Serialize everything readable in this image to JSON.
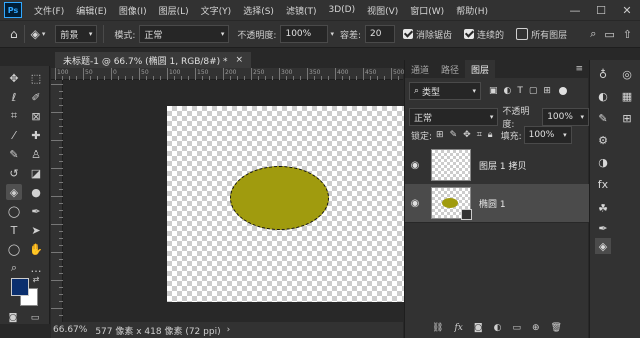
{
  "app": {
    "logo": "Ps"
  },
  "menu": [
    "文件(F)",
    "编辑(E)",
    "图像(I)",
    "图层(L)",
    "文字(Y)",
    "选择(S)",
    "滤镜(T)",
    "3D(D)",
    "视图(V)",
    "窗口(W)",
    "帮助(H)"
  ],
  "window_controls": {
    "minimize": "—",
    "maximize": "☐",
    "close": "✕"
  },
  "options": {
    "preset": "前景",
    "mode_label": "模式:",
    "mode_value": "正常",
    "opacity_label": "不透明度:",
    "opacity_value": "100%",
    "tolerance_label": "容差:",
    "tolerance_value": "20",
    "antialias_label": "消除锯齿",
    "antialias_checked": true,
    "contiguous_label": "连续的",
    "contiguous_checked": true,
    "all_layers_label": "所有图层",
    "all_layers_checked": false
  },
  "document": {
    "tab_title": "未标题-1 @ 66.7% (椭圆 1, RGB/8#) *",
    "tab_close": "×",
    "zoom": "66.67%",
    "status_info": "577 像素 x 418 像素 (72 ppi)",
    "status_arrow": "›",
    "ellipse_color": "#a09b0e",
    "ruler_labels": [
      "100",
      "50",
      "0",
      "50",
      "100",
      "150",
      "200",
      "250",
      "300",
      "350",
      "400",
      "450",
      "500"
    ]
  },
  "colors": {
    "foreground": "#0b2f6e",
    "background": "#ffffff",
    "accent": "#31a8ff"
  },
  "layers_panel": {
    "tabs": [
      "通道",
      "路径",
      "图层"
    ],
    "active_tab": "图层",
    "panel_menu": "≡",
    "filter_kind": "类型",
    "blend_mode": "正常",
    "opacity_label": "不透明度:",
    "opacity_value": "100%",
    "lock_label": "锁定:",
    "fill_label": "填充:",
    "fill_value": "100%",
    "layers": [
      {
        "name": "图层 1 拷贝",
        "visible": true,
        "selected": false
      },
      {
        "name": "椭圆 1",
        "visible": true,
        "selected": true
      }
    ],
    "footer_icons": [
      "link-icon",
      "fx-icon",
      "mask-icon",
      "adjustment-icon",
      "folder-icon",
      "new-layer-icon",
      "trash-icon"
    ]
  }
}
